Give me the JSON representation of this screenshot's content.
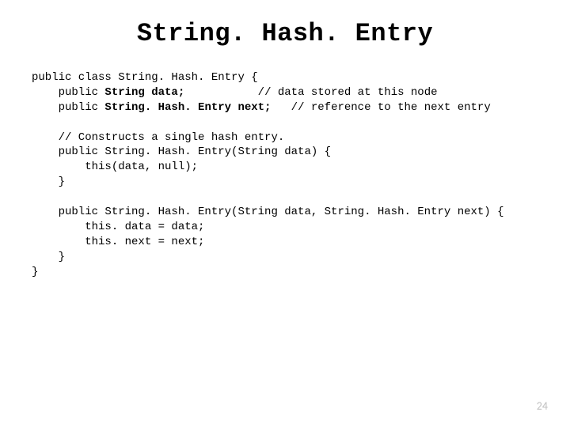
{
  "title": "String. Hash. Entry",
  "code": {
    "l1a": "public class String. Hash. Entry {",
    "l2a": "    public ",
    "l2b": "String data;",
    "l2c": "           // data stored at this node",
    "l3a": "    public ",
    "l3b": "String. Hash. Entry next;",
    "l3c": "   // reference to the next entry",
    "blank1": "",
    "l4": "    // Constructs a single hash entry.",
    "l5": "    public String. Hash. Entry(String data) {",
    "l6": "        this(data, null);",
    "l7": "    }",
    "blank2": "",
    "l8": "    public String. Hash. Entry(String data, String. Hash. Entry next) {",
    "l9": "        this. data = data;",
    "l10": "        this. next = next;",
    "l11": "    }",
    "l12": "}"
  },
  "page_number": "24"
}
